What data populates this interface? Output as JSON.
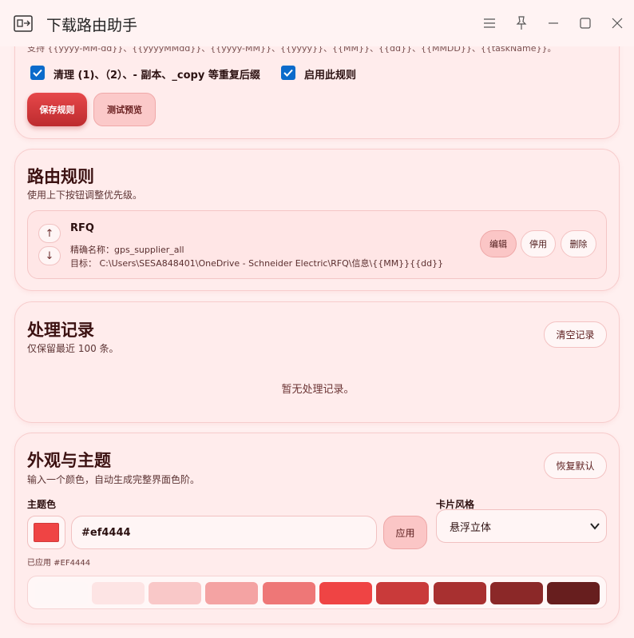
{
  "window": {
    "title": "下载路由助手",
    "icons": [
      "menu-icon",
      "pin-icon",
      "minimize-icon",
      "maximize-icon",
      "close-icon"
    ]
  },
  "rule_editor": {
    "hint": "支持 {{yyyy-MM-dd}}、{{yyyyMMdd}}、{{yyyy-MM}}、{{yyyy}}、{{MM}}、{{dd}}、{{MMDD}}、{{taskName}}。",
    "checkbox_dedupe_label": "清理 (1)、（2）、- 副本、_copy 等重复后缀",
    "checkbox_dedupe_checked": true,
    "checkbox_enable_label": "启用此规则",
    "checkbox_enable_checked": true,
    "save_label": "保存规则",
    "test_label": "测试预览"
  },
  "routes": {
    "title": "路由规则",
    "subtitle": "使用上下按钮调整优先级。",
    "items": [
      {
        "name": "RFQ",
        "match": "精确名称：gps_supplier_all",
        "target": "目标：  C:\\Users\\SESA848401\\OneDrive - Schneider Electric\\RFQ\\信息\\{{MM}}{{dd}}",
        "edit_label": "编辑",
        "disable_label": "停用",
        "delete_label": "删除"
      }
    ]
  },
  "history": {
    "title": "处理记录",
    "subtitle": "仅保留最近 100 条。",
    "clear_label": "清空记录",
    "empty_text": "暂无处理记录。"
  },
  "theme": {
    "title": "外观与主题",
    "subtitle": "输入一个颜色，自动生成完整界面色阶。",
    "reset_label": "恢复默认",
    "color_label": "主题色",
    "color_value": "#ef4444",
    "apply_label": "应用",
    "applied_text": "已应用 #EF4444",
    "card_style_label": "卡片风格",
    "card_style_value": "悬浮立体",
    "palette": [
      "#fef7f7",
      "#fde4e4",
      "#f9c8c8",
      "#f4a3a3",
      "#ee7777",
      "#ef4444",
      "#c93a3a",
      "#a83030",
      "#8b2828",
      "#671e1e"
    ]
  }
}
